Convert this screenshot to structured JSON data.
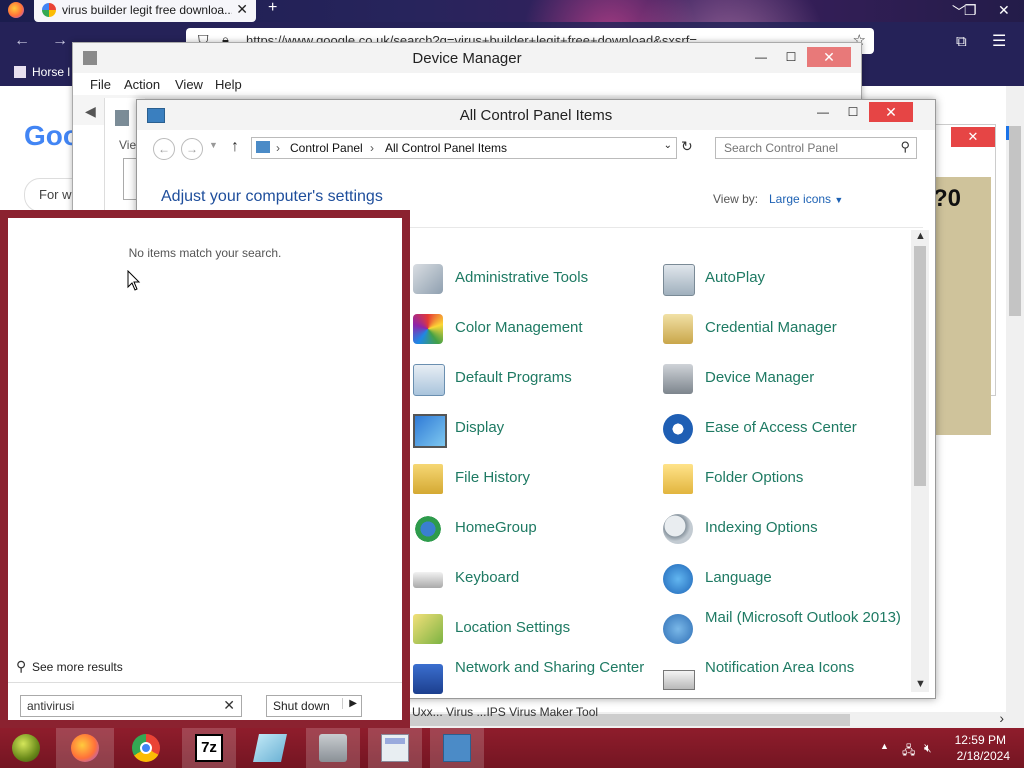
{
  "firefox": {
    "tab_title": "virus builder legit free downloa...",
    "url": "https://www.google.co.uk/search?q=virus+builder+legit+free+download&sxsrf=...",
    "bookmark": "Horse l",
    "google_logo": "Goo",
    "search_partial": "For w",
    "bottom_text": "Uxx... Virus ...IPS Virus Maker Tool"
  },
  "bg_window": {
    "text": "?0"
  },
  "device_manager": {
    "title": "Device Manager",
    "menu": [
      "File",
      "Action",
      "View",
      "Help"
    ],
    "inner_label": "Vie"
  },
  "control_panel": {
    "title": "All Control Panel Items",
    "breadcrumb": [
      "Control Panel",
      "All Control Panel Items"
    ],
    "search_placeholder": "Search Control Panel",
    "heading": "Adjust your computer's settings",
    "view_by_label": "View by:",
    "view_by_value": "Large icons",
    "items_left": [
      {
        "label": "Administrative Tools",
        "icon": "admin-tools-icon"
      },
      {
        "label": "Color Management",
        "icon": "color-management-icon"
      },
      {
        "label": "Default Programs",
        "icon": "default-programs-icon"
      },
      {
        "label": "Display",
        "icon": "display-icon"
      },
      {
        "label": "File History",
        "icon": "file-history-icon"
      },
      {
        "label": "HomeGroup",
        "icon": "homegroup-icon"
      },
      {
        "label": "Keyboard",
        "icon": "keyboard-icon"
      },
      {
        "label": "Location Settings",
        "icon": "location-settings-icon"
      },
      {
        "label": "Network and Sharing Center",
        "icon": "network-icon"
      }
    ],
    "items_right": [
      {
        "label": "AutoPlay",
        "icon": "autoplay-icon"
      },
      {
        "label": "Credential Manager",
        "icon": "credential-manager-icon"
      },
      {
        "label": "Device Manager",
        "icon": "device-manager-icon"
      },
      {
        "label": "Ease of Access Center",
        "icon": "ease-of-access-icon"
      },
      {
        "label": "Folder Options",
        "icon": "folder-options-icon"
      },
      {
        "label": "Indexing Options",
        "icon": "indexing-options-icon"
      },
      {
        "label": "Language",
        "icon": "language-icon"
      },
      {
        "label": "Mail (Microsoft Outlook 2013)",
        "icon": "mail-icon"
      },
      {
        "label": "Notification Area Icons",
        "icon": "notification-area-icon"
      }
    ]
  },
  "start_search": {
    "no_results": "No items match your search.",
    "see_more": "See more results",
    "query": "antivirusi",
    "shutdown": "Shut down"
  },
  "taskbar": {
    "apps": [
      "start-orb",
      "firefox",
      "chrome",
      "7-zip",
      "notepad",
      "device-manager",
      "calculator",
      "control-panel"
    ],
    "time": "12:59 PM",
    "date": "2/18/2024"
  },
  "colors": {
    "accent_red": "#8b2230",
    "link_green": "#1e7a63",
    "heading_blue": "#1e4e9c"
  }
}
